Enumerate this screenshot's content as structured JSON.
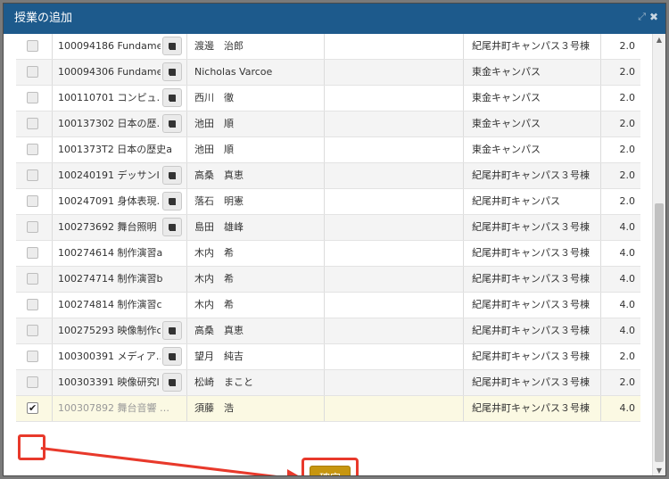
{
  "dialog": {
    "title": "授業の追加",
    "expand_icon": "expand-icon",
    "close_icon": "close-icon",
    "confirm_label": "確定"
  },
  "rows": [
    {
      "course": "100094186 Fundame…",
      "teacher": "渡邊　治郎",
      "campus": "紀尾井町キャンパス３号棟",
      "credits": "2.0",
      "book": true,
      "checked": false
    },
    {
      "course": "100094306 Fundame…",
      "teacher": "Nicholas Varcoe",
      "campus": "東金キャンパス",
      "credits": "2.0",
      "book": true,
      "checked": false
    },
    {
      "course": "100110701 コンピュ…",
      "teacher": "西川　徹",
      "campus": "東金キャンパス",
      "credits": "2.0",
      "book": true,
      "checked": false
    },
    {
      "course": "100137302 日本の歴…",
      "teacher": "池田　順",
      "campus": "東金キャンパス",
      "credits": "2.0",
      "book": true,
      "checked": false
    },
    {
      "course": "1001373T2 日本の歴史a",
      "teacher": "池田　順",
      "campus": "東金キャンパス",
      "credits": "2.0",
      "book": false,
      "checked": false
    },
    {
      "course": "100240191 デッサンI…",
      "teacher": "高桑　真恵",
      "campus": "紀尾井町キャンパス３号棟",
      "credits": "2.0",
      "book": true,
      "checked": false
    },
    {
      "course": "100247091 身体表現…",
      "teacher": "落石　明憲",
      "campus": "紀尾井町キャンパス",
      "credits": "2.0",
      "book": true,
      "checked": false
    },
    {
      "course": "100273692 舞台照明 …",
      "teacher": "島田　雄峰",
      "campus": "紀尾井町キャンパス３号棟",
      "credits": "4.0",
      "book": true,
      "checked": false
    },
    {
      "course": "100274614 制作演習a",
      "teacher": "木内　希",
      "campus": "紀尾井町キャンパス３号棟",
      "credits": "4.0",
      "book": false,
      "checked": false
    },
    {
      "course": "100274714 制作演習b",
      "teacher": "木内　希",
      "campus": "紀尾井町キャンパス３号棟",
      "credits": "4.0",
      "book": false,
      "checked": false
    },
    {
      "course": "100274814 制作演習c",
      "teacher": "木内　希",
      "campus": "紀尾井町キャンパス３号棟",
      "credits": "4.0",
      "book": false,
      "checked": false
    },
    {
      "course": "100275293 映像制作c…",
      "teacher": "高桑　真恵",
      "campus": "紀尾井町キャンパス３号棟",
      "credits": "4.0",
      "book": true,
      "checked": false
    },
    {
      "course": "100300391 メディア…",
      "teacher": "望月　純吉",
      "campus": "紀尾井町キャンパス３号棟",
      "credits": "2.0",
      "book": true,
      "checked": false
    },
    {
      "course": "100303391 映像研究I",
      "teacher": "松崎　まこと",
      "campus": "紀尾井町キャンパス３号棟",
      "credits": "2.0",
      "book": true,
      "checked": false
    },
    {
      "course": "100307892 舞台音響 …",
      "teacher": "須藤　浩",
      "campus": "紀尾井町キャンパス３号棟",
      "credits": "4.0",
      "book": false,
      "checked": true
    }
  ],
  "colors": {
    "titlebar": "#1d5a8c",
    "confirm_button": "#c7960f",
    "highlight": "#e8392b"
  }
}
